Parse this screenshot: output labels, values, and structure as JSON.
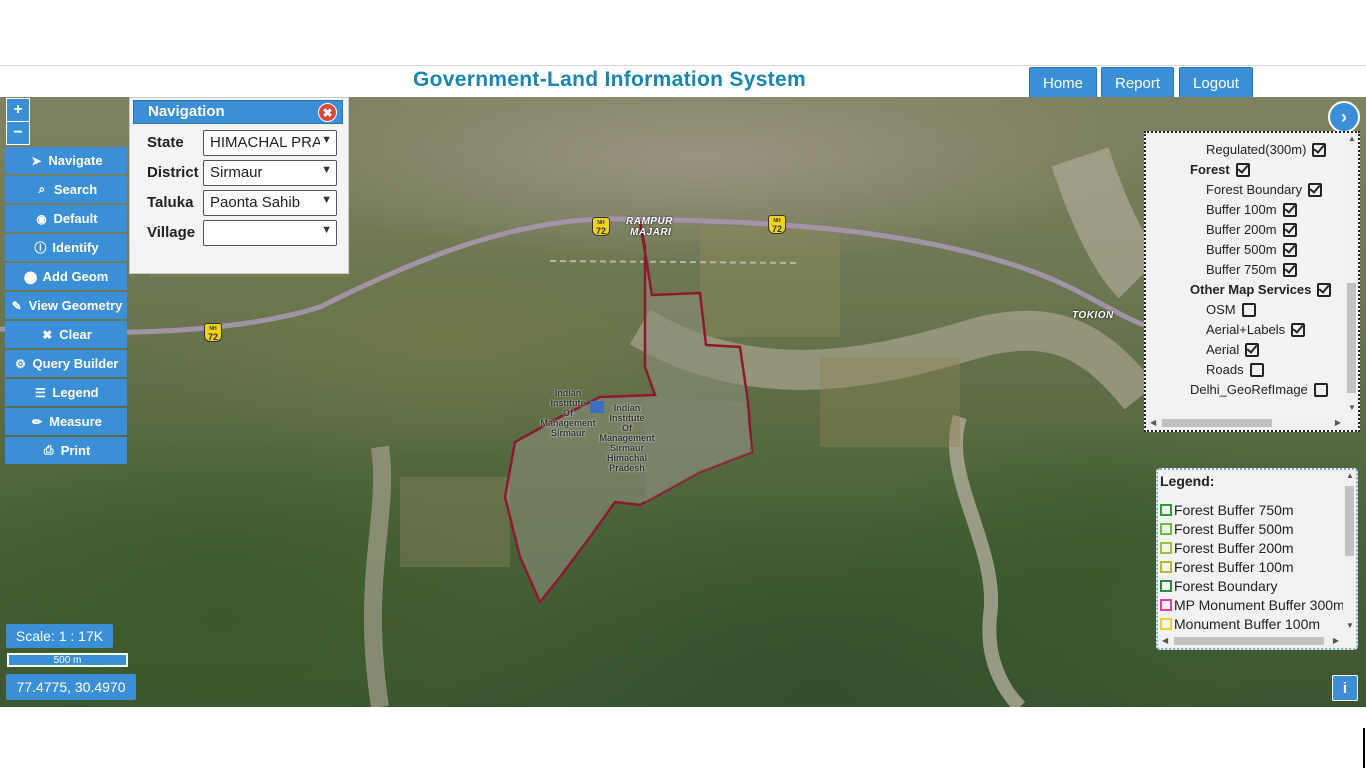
{
  "header": {
    "title": "Government-Land Information System",
    "buttons": {
      "home": "Home",
      "report": "Report",
      "logout": "Logout"
    }
  },
  "zoom": {
    "in": "+",
    "out": "−"
  },
  "toolbar": [
    {
      "label": "Navigate",
      "icon": "send-icon",
      "glyph": "➤"
    },
    {
      "label": "Search",
      "icon": "search-icon",
      "glyph": "⌕"
    },
    {
      "label": "Default",
      "icon": "globe-icon",
      "glyph": "◉"
    },
    {
      "label": "Identify",
      "icon": "info-circle-icon",
      "glyph": "ⓘ"
    },
    {
      "label": "Add Geom",
      "icon": "map-marker-icon",
      "glyph": "⬤"
    },
    {
      "label": "View Geometry",
      "icon": "pin-icon",
      "glyph": "✎"
    },
    {
      "label": "Clear",
      "icon": "close-icon",
      "glyph": "✖"
    },
    {
      "label": "Query Builder",
      "icon": "gear-icon",
      "glyph": "⚙"
    },
    {
      "label": "Legend",
      "icon": "list-icon",
      "glyph": "☰"
    },
    {
      "label": "Measure",
      "icon": "pencil-icon",
      "glyph": "✏"
    },
    {
      "label": "Print",
      "icon": "print-icon",
      "glyph": "⎙"
    }
  ],
  "navigation": {
    "title": "Navigation",
    "state": {
      "label": "State",
      "value": "HIMACHAL PRA"
    },
    "district": {
      "label": "District",
      "value": "Sirmaur"
    },
    "taluka": {
      "label": "Taluka",
      "value": "Paonta Sahib"
    },
    "village": {
      "label": "Village",
      "value": ""
    }
  },
  "layers": [
    {
      "label": "Regulated(300m)",
      "checked": true,
      "bold": false
    },
    {
      "label": "Forest",
      "checked": true,
      "bold": true
    },
    {
      "label": "Forest Boundary",
      "checked": true,
      "bold": false
    },
    {
      "label": "Buffer 100m",
      "checked": true,
      "bold": false
    },
    {
      "label": "Buffer 200m",
      "checked": true,
      "bold": false
    },
    {
      "label": "Buffer 500m",
      "checked": true,
      "bold": false
    },
    {
      "label": "Buffer 750m",
      "checked": true,
      "bold": false
    },
    {
      "label": "Other Map Services",
      "checked": true,
      "bold": true
    },
    {
      "label": "OSM",
      "checked": false,
      "bold": false
    },
    {
      "label": "Aerial+Labels",
      "checked": true,
      "bold": false
    },
    {
      "label": "Aerial",
      "checked": true,
      "bold": false
    },
    {
      "label": "Roads",
      "checked": false,
      "bold": false
    },
    {
      "label": "Delhi_GeoRefImage",
      "checked": false,
      "bold": false
    }
  ],
  "legend": {
    "title": "Legend:",
    "items": [
      {
        "label": "Forest Buffer 750m",
        "color": "#2e9a3a"
      },
      {
        "label": "Forest Buffer 500m",
        "color": "#6abf3a"
      },
      {
        "label": "Forest Buffer 200m",
        "color": "#9cc23a"
      },
      {
        "label": "Forest Buffer 100m",
        "color": "#b5b83a"
      },
      {
        "label": "Forest Boundary",
        "color": "#2e8a3a"
      },
      {
        "label": "MP Monument Buffer 300m",
        "color": "#e040a0"
      },
      {
        "label": "Monument Buffer 100m",
        "color": "#e8d040"
      }
    ]
  },
  "map": {
    "labels": {
      "rampur": "RAMPUR",
      "majari": "MAJARI",
      "tokion": "TOKION"
    },
    "institute_left": [
      "Indian",
      "Institute",
      "Of",
      "Management",
      "Sirmaur"
    ],
    "institute_right": [
      "Indian",
      "Institute",
      "Of",
      "Management",
      "Sirmaur",
      "Himachal",
      "Pradesh"
    ],
    "highway": {
      "prefix": "NH",
      "number": "72"
    }
  },
  "scale": {
    "ratio": "Scale: 1 : 17K",
    "bar": "500 m"
  },
  "coordinates": "77.4775, 30.4970",
  "info": "i",
  "expand": "›",
  "colors": {
    "accent": "#3b8fd6",
    "title": "#1a86b0",
    "boundary": "#8b1a2e"
  }
}
